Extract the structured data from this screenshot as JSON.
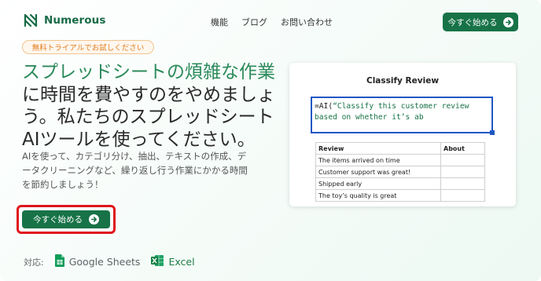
{
  "brand": {
    "name": "Numerous",
    "color": "#176b46"
  },
  "nav": {
    "items": [
      {
        "label": "機能"
      },
      {
        "label": "ブログ"
      },
      {
        "label": "お問い合わせ"
      }
    ],
    "cta_label": "今すぐ始める"
  },
  "hero": {
    "trial_pill": "無料トライアルでお試しください",
    "headline_accent": "スプレッドシートの煩雑な作業",
    "headline_lines": [
      "に時間を費やすのをやめましょ",
      "う。私たちのスプレッドシート",
      "AIツールを使ってください。"
    ],
    "subtext_lines": [
      "AIを使って、カテゴリ分け、抽出、テキストの作成、デ",
      "ータクリーニングなど、繰り返し行う作業にかかる時間",
      "を節約しましょう！"
    ],
    "cta_label": "今すぐ始める",
    "support_label": "対応:",
    "support_apps": [
      "Google Sheets",
      "Excel"
    ]
  },
  "demo_card": {
    "title": "Classify Review",
    "formula_prefix": "=AI(",
    "formula_line1_string": "“Classify this customer review",
    "formula_line2_string": "based on whether it’s ab",
    "table": {
      "headers": [
        "Review",
        "About"
      ],
      "rows": [
        [
          "The items arrived on time",
          ""
        ],
        [
          "Customer support was great!",
          ""
        ],
        [
          "Shipped early",
          ""
        ],
        [
          "The toy’s quality is great",
          ""
        ]
      ]
    }
  },
  "colors": {
    "accent_green": "#177347",
    "headline_green": "#2c8a5b",
    "pill_orange": "#e07d1f",
    "highlight_red": "#e0151b",
    "formula_blue": "#1f57c3"
  }
}
